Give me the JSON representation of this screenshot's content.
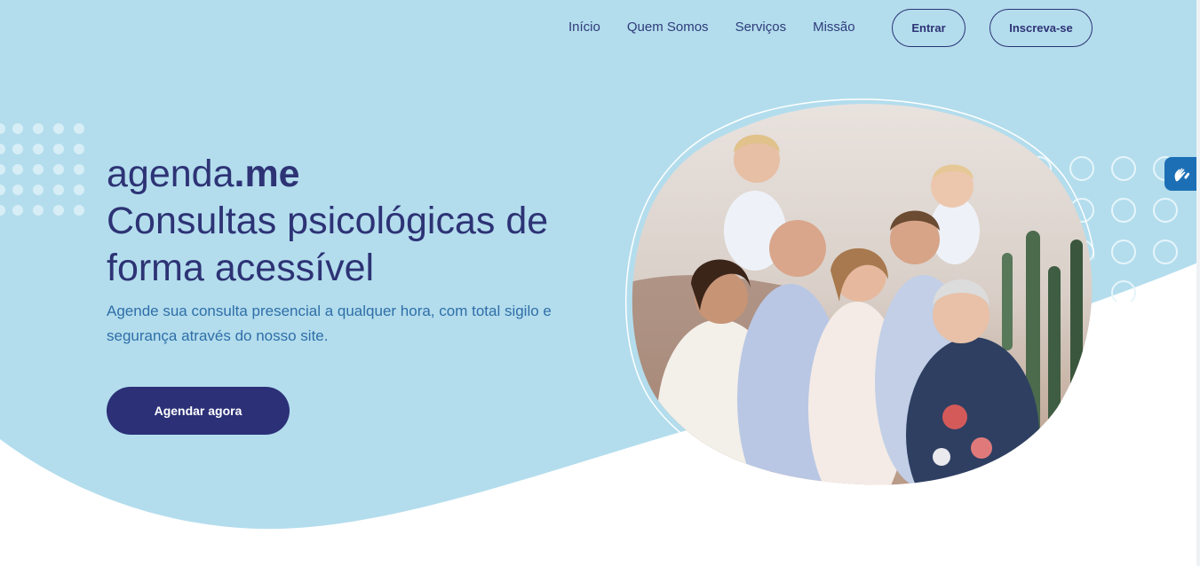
{
  "nav": {
    "items": [
      {
        "label": "Início"
      },
      {
        "label": "Quem Somos"
      },
      {
        "label": "Serviços"
      },
      {
        "label": "Missão"
      }
    ],
    "login_label": "Entrar",
    "signup_label": "Inscreva-se"
  },
  "hero": {
    "brand_light": "agenda",
    "brand_bold": ".me",
    "title_line1": "Consultas psicológicas de",
    "title_line2": "forma acessível",
    "subtitle": "Agende sua consulta presencial a qualquer hora, com total sigilo e segurança através do nosso site.",
    "cta_label": "Agendar agora"
  },
  "colors": {
    "hero_bg": "#b3dded",
    "brand_dark": "#2b3077",
    "subtitle_blue": "#2f6ea8",
    "widget_blue": "#1c6fb5"
  },
  "icons": {
    "accessibility_widget": "sign-language-hands-icon"
  }
}
